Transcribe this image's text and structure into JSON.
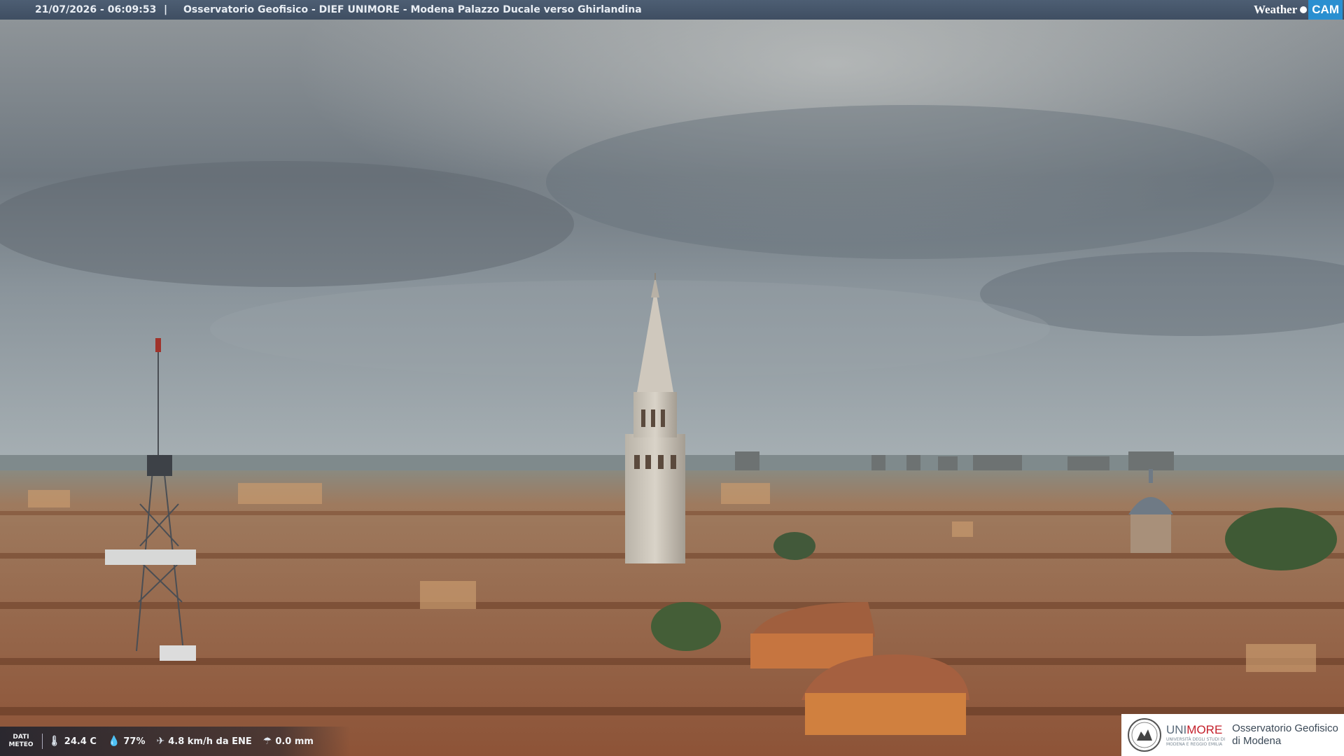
{
  "header": {
    "timestamp": "21/07/2026 - 06:09:53",
    "separator": "|",
    "title": "Osservatorio Geofisico - DIEF UNIMORE - Modena Palazzo Ducale verso Ghirlandina"
  },
  "logo": {
    "weather": "Weather",
    "cam": "CAM"
  },
  "meteo": {
    "label_line1": "DATI",
    "label_line2": "METEO",
    "temperature": "24.4 C",
    "humidity": "77%",
    "wind": "4.8 km/h da ENE",
    "rain": "0.0 mm",
    "icons": [
      "thermometer-icon",
      "humidity-drop-icon",
      "wind-vane-icon",
      "rain-gauge-icon"
    ]
  },
  "footer_logo": {
    "uni_a": "UNI",
    "uni_b": "MORE",
    "uni_sub1": "UNIVERSITÀ DEGLI STUDI DI",
    "uni_sub2": "MODENA E REGGIO EMILIA",
    "obs_line1": "Osservatorio Geofisico",
    "obs_line2": "di Modena"
  },
  "colors": {
    "sky": "#7d8590",
    "roofs": "#a96a48",
    "bar": "#43536a",
    "brand_red": "#c4202b",
    "cam_blue": "#2a8fd0"
  }
}
